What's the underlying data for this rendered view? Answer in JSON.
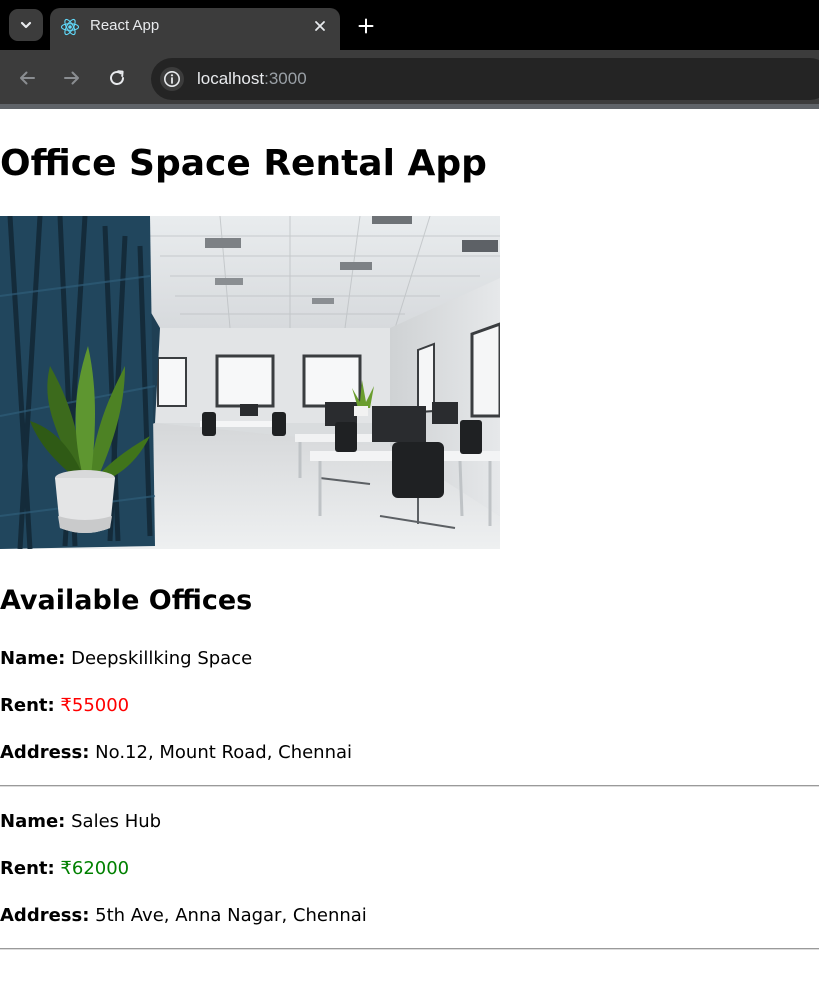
{
  "browser": {
    "tab_title": "React App",
    "url_host": "localhost",
    "url_port": ":3000",
    "icons": {
      "tab_search": "chevron-down-icon",
      "favicon": "react-icon",
      "close": "close-icon",
      "new_tab": "plus-icon",
      "back": "arrow-left-icon",
      "forward": "arrow-right-icon",
      "reload": "reload-icon",
      "site_info": "info-icon"
    }
  },
  "page": {
    "title": "Office Space Rental App",
    "section_title": "Available Offices",
    "labels": {
      "name": "Name:",
      "rent": "Rent:",
      "address": "Address:"
    },
    "offices": [
      {
        "name": "Deepskillking Space",
        "rent": "₹55000",
        "rent_color": "#ff0000",
        "address": "No.12, Mount Road, Chennai"
      },
      {
        "name": "Sales Hub",
        "rent": "₹62000",
        "rent_color": "#008000",
        "address": "5th Ave, Anna Nagar, Chennai"
      }
    ]
  }
}
